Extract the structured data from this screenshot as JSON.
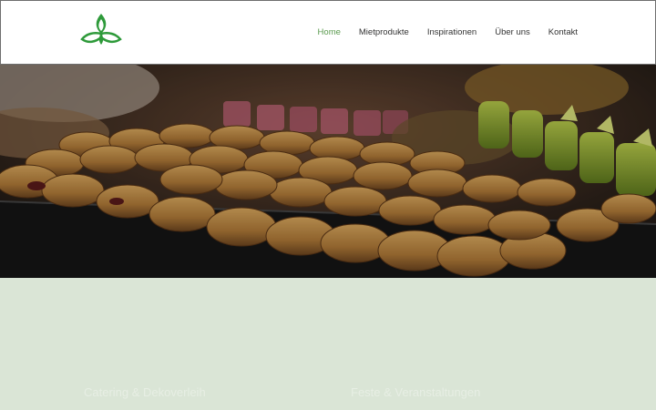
{
  "header": {
    "logo_icon": "lotus-leaf-logo",
    "nav": [
      {
        "label": "Home",
        "active": true
      },
      {
        "label": "Mietprodukte",
        "active": false
      },
      {
        "label": "Inspirationen",
        "active": false
      },
      {
        "label": "Über uns",
        "active": false
      },
      {
        "label": "Kontakt",
        "active": false
      }
    ]
  },
  "colors": {
    "accent_green": "#5a9a4e",
    "logo_green": "#2e9a3a",
    "section_bg": "#dae5d6"
  },
  "hero": {
    "image": "pastries-buffet-photo"
  },
  "section": {
    "heading_left": "Catering & Dekoverleih",
    "heading_right": "Feste & Veranstaltungen"
  }
}
